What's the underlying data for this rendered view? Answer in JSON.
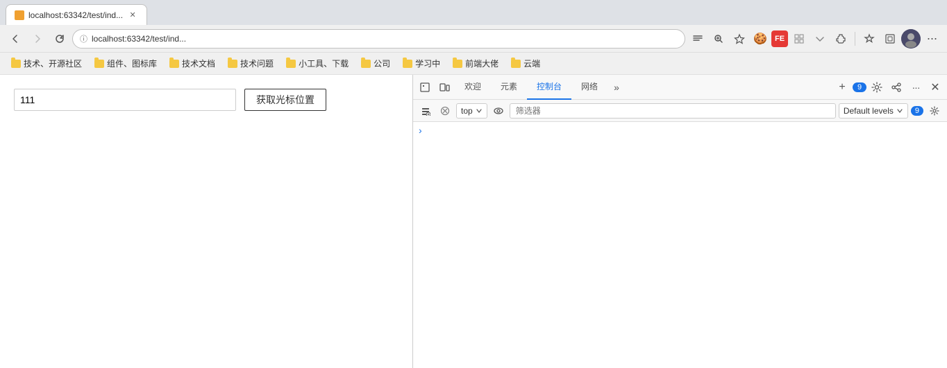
{
  "browser": {
    "tab": {
      "title": "localhost:63342/test/ind...",
      "favicon_color": "#f0a030"
    },
    "nav": {
      "back_disabled": false,
      "forward_disabled": true,
      "address": "localhost:63342/test/ind...",
      "address_full": "localhost:63342/test/ind..."
    },
    "bookmarks": [
      {
        "label": "技术、开源社区"
      },
      {
        "label": "组件、图标库"
      },
      {
        "label": "技术文档"
      },
      {
        "label": "技术问题"
      },
      {
        "label": "小工具、下载"
      },
      {
        "label": "公司"
      },
      {
        "label": "学习中"
      },
      {
        "label": "前端大佬"
      },
      {
        "label": "云端"
      }
    ]
  },
  "page": {
    "input_value": "111",
    "input_placeholder": "",
    "button_label": "获取光标位置"
  },
  "devtools": {
    "toolbar": {
      "tabs": [
        {
          "label": "欢迎",
          "active": false
        },
        {
          "label": "元素",
          "active": false
        },
        {
          "label": "控制台",
          "active": true
        },
        {
          "label": "网络",
          "active": false
        }
      ],
      "badge_count": "9",
      "add_label": "+",
      "overflow_label": "»"
    },
    "toolbar2": {
      "context": "top",
      "filter_placeholder": "筛选器",
      "level": "Default levels",
      "badge_count": "9"
    },
    "console": {
      "arrow": "›"
    }
  }
}
